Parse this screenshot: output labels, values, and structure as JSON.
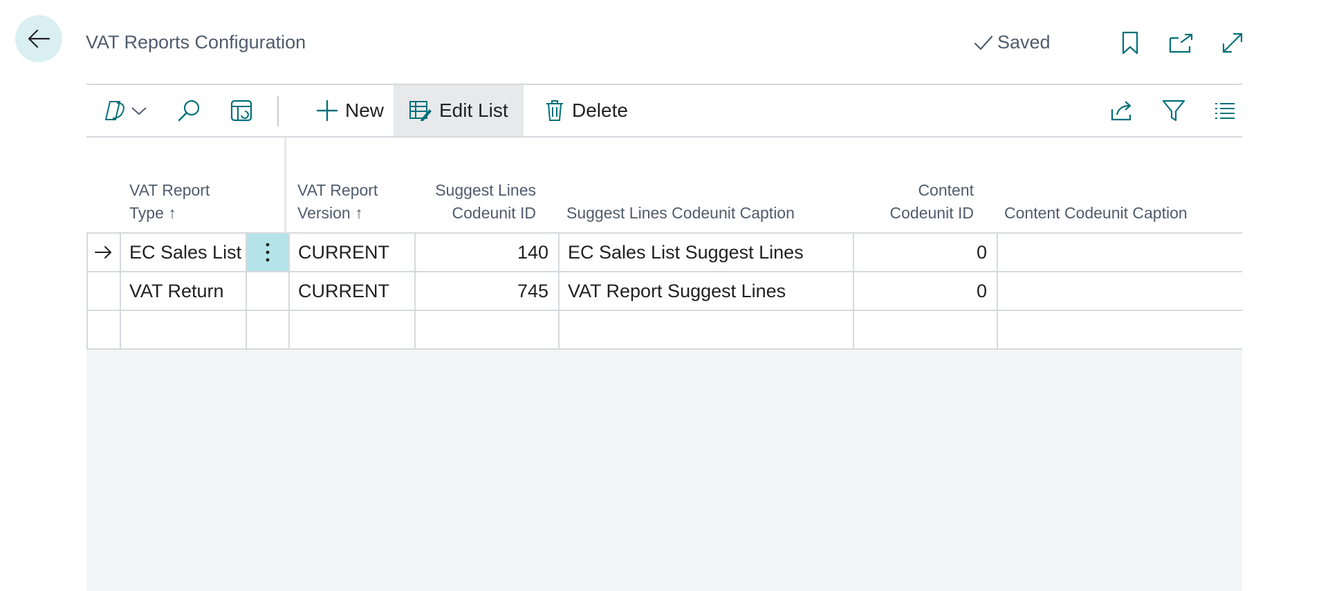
{
  "header": {
    "title": "VAT Reports Configuration",
    "saved_status": "Saved"
  },
  "toolbar": {
    "new_label": "New",
    "edit_list_label": "Edit List",
    "delete_label": "Delete"
  },
  "table": {
    "columns": [
      {
        "line1": "VAT Report",
        "line2": "Type ↑"
      },
      {
        "line1": "VAT Report",
        "line2": "Version ↑"
      },
      {
        "line1": "Suggest Lines",
        "line2": "Codeunit ID"
      },
      {
        "line1": "",
        "line2": "Suggest Lines Codeunit Caption"
      },
      {
        "line1": "Content",
        "line2": "Codeunit ID"
      },
      {
        "line1": "",
        "line2": "Content Codeunit Caption"
      }
    ],
    "rows": [
      {
        "type": "EC Sales List",
        "version": "CURRENT",
        "suggest_id": "140",
        "suggest_caption": "EC Sales List Suggest Lines",
        "content_id": "0",
        "content_caption": ""
      },
      {
        "type": "VAT Return",
        "version": "CURRENT",
        "suggest_id": "745",
        "suggest_caption": "VAT Report Suggest Lines",
        "content_id": "0",
        "content_caption": ""
      },
      {
        "type": "",
        "version": "",
        "suggest_id": "",
        "suggest_caption": "",
        "content_id": "",
        "content_caption": ""
      }
    ]
  },
  "colors": {
    "accent": "#00707a",
    "active_cell": "#b4e4ea",
    "back_button_bg": "#d9eff2"
  }
}
